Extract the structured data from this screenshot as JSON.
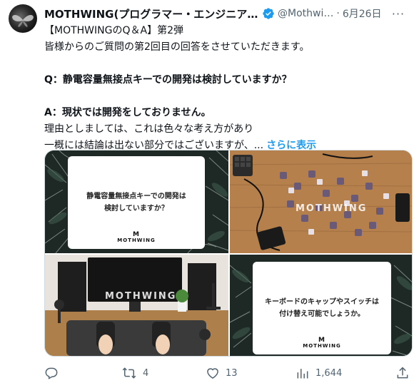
{
  "author": {
    "display_name": "MOTHWING(プログラマー・エンジニア向…",
    "handle": "@Mothwi…",
    "separator": "·",
    "date": "6月26日",
    "verified_color": "#1d9bf0"
  },
  "tweet": {
    "line1": "【MOTHWINGのQ＆A】第2弾",
    "line2": "皆様からのご質問の第2回目の回答をさせていただきます。",
    "line3": "Q：静電容量無接点キーでの開発は検討していますか？",
    "line4": "A：現状では開発をしておりません。",
    "line5": "理由としましては、これは色々な考え方があり",
    "line6": "一概には結論は出ない部分ではございますが、...",
    "show_more": "さらに表示"
  },
  "media": {
    "card1_text": "静電容量無接点キーでの開発は\n検討していますか？",
    "card2_text": "キーボードのキャップやスイッチは\n付け替え可能でしょうか。",
    "logo_mark": "M",
    "logo_text": "MOTHWING"
  },
  "actions": {
    "reply_count": "",
    "retweet_count": "4",
    "like_count": "13",
    "views_count": "1,644"
  },
  "colors": {
    "accent": "#1d9bf0",
    "muted": "#536471",
    "text": "#0f1419",
    "border": "#cfd9de"
  }
}
